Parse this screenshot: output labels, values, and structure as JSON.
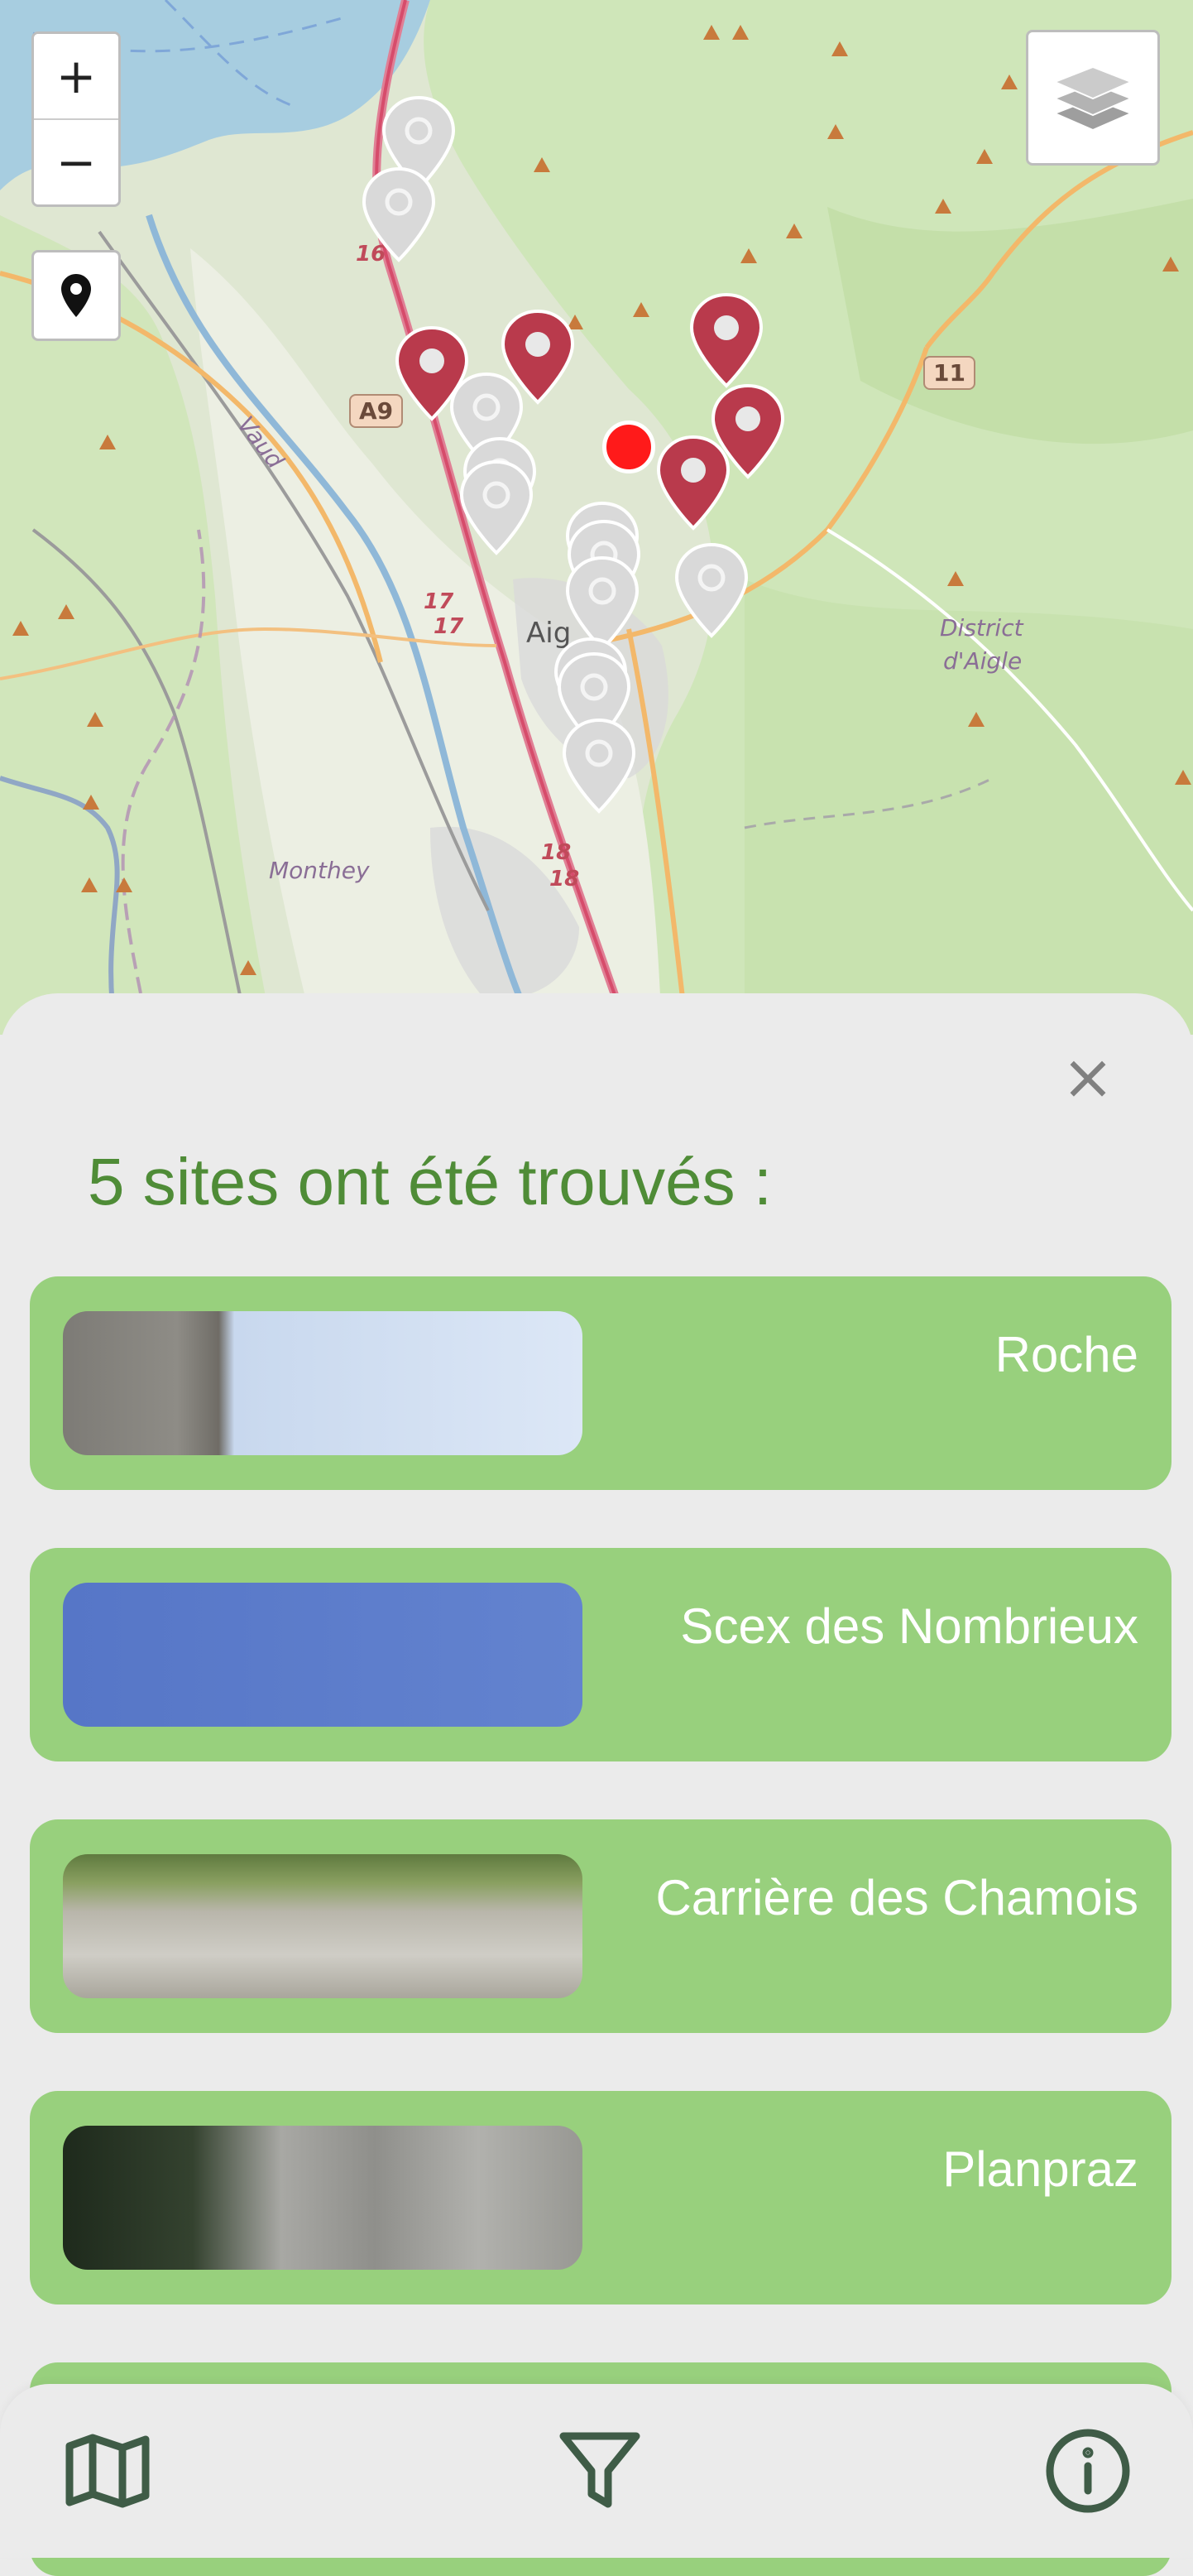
{
  "map": {
    "labels": {
      "vaud": "Vaud",
      "monthey": "Monthey",
      "district": "District",
      "daigle": "d'Aigle",
      "aigle": "Aig"
    },
    "shields": {
      "a9": "A9",
      "route11": "11"
    },
    "road_numbers": [
      "16",
      "17",
      "17",
      "18",
      "18"
    ],
    "controls": {
      "zoom_in": "+",
      "zoom_out": "−"
    },
    "colors": {
      "pin_active": "#b93a4c",
      "pin_inactive": "#d9d9d9",
      "user_location": "#ff1a1a"
    }
  },
  "sheet": {
    "close_label": "×",
    "title": "5 sites ont été trouvés :",
    "sites": [
      {
        "name": "Roche",
        "thumb": "cliff-sky"
      },
      {
        "name": "Scex des Nombrieux",
        "thumb": "blue-sky"
      },
      {
        "name": "Carrière des Chamois",
        "thumb": "rock-face-grass"
      },
      {
        "name": "Planpraz",
        "thumb": "forest-cliff"
      },
      {
        "name": "",
        "thumb": ""
      }
    ]
  },
  "nav": {
    "icons": [
      "map-icon",
      "filter-icon",
      "info-icon"
    ],
    "color": "#3f5c47"
  }
}
